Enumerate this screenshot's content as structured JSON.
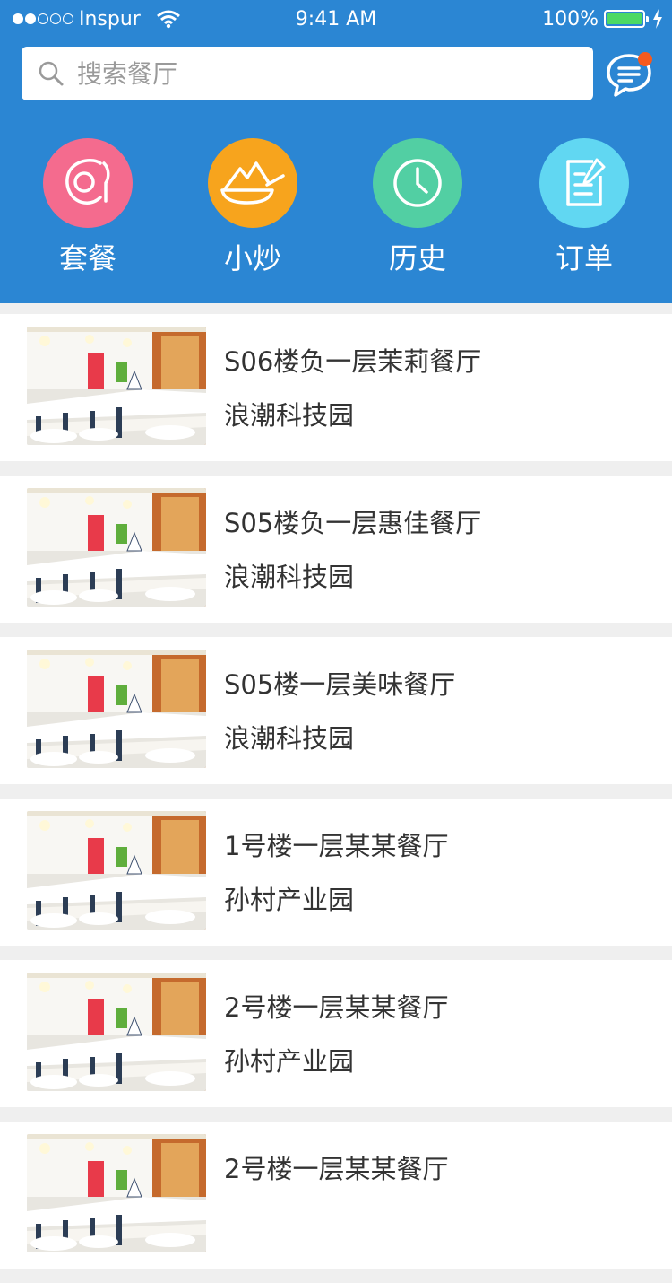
{
  "status_bar": {
    "carrier": "Inspur",
    "time": "9:41 AM",
    "battery": "100%"
  },
  "search": {
    "placeholder": "搜索餐厅"
  },
  "categories": [
    {
      "label": "套餐",
      "icon": "plate-icon",
      "color": "#f46b8e"
    },
    {
      "label": "小炒",
      "icon": "dish-icon",
      "color": "#f7a41d"
    },
    {
      "label": "历史",
      "icon": "clock-icon",
      "color": "#52cfa3"
    },
    {
      "label": "订单",
      "icon": "order-icon",
      "color": "#61d7f2"
    }
  ],
  "restaurants": [
    {
      "name": "S06楼负一层茉莉餐厅",
      "location": "浪潮科技园"
    },
    {
      "name": "S05楼负一层惠佳餐厅",
      "location": "浪潮科技园"
    },
    {
      "name": "S05楼一层美味餐厅",
      "location": "浪潮科技园"
    },
    {
      "name": "1号楼一层某某餐厅",
      "location": "孙村产业园"
    },
    {
      "name": "2号楼一层某某餐厅",
      "location": "孙村产业园"
    },
    {
      "name": "2号楼一层某某餐厅",
      "location": ""
    }
  ],
  "colors": {
    "header": "#2b86d3",
    "notification_dot": "#f65a1e"
  }
}
